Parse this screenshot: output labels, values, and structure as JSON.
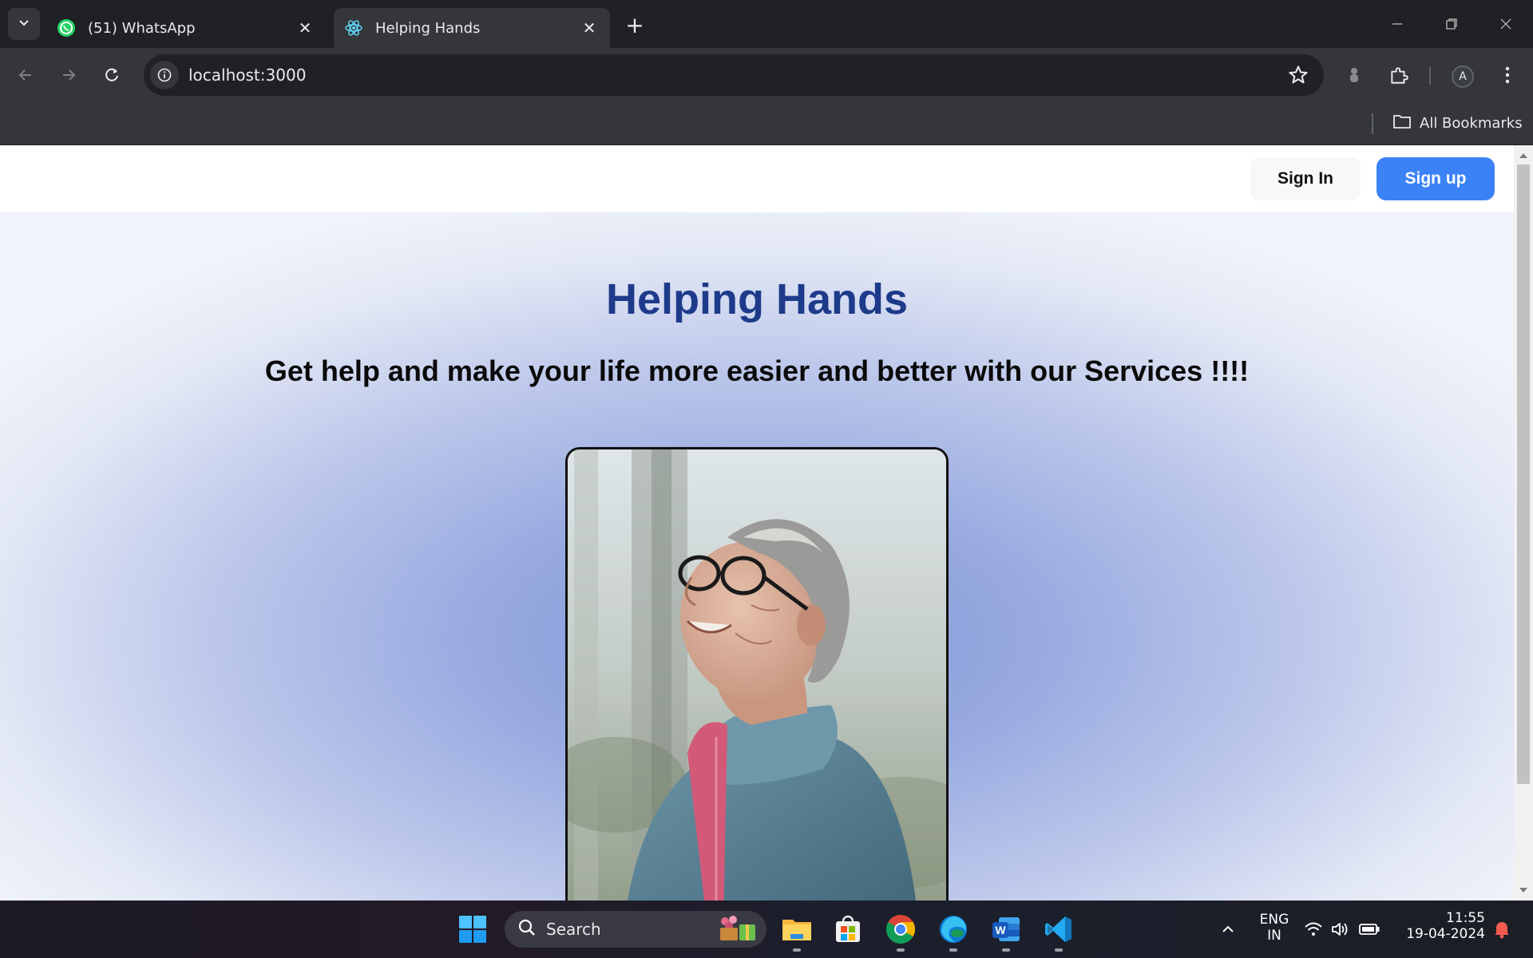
{
  "browser": {
    "tabs": [
      {
        "title": "(51) WhatsApp",
        "active": false,
        "icon": "whatsapp-icon"
      },
      {
        "title": "Helping Hands",
        "active": true,
        "icon": "react-icon"
      }
    ],
    "url": "localhost:3000",
    "bookmarks_label": "All Bookmarks",
    "profile_initial": "A"
  },
  "page": {
    "nav": {
      "signin_label": "Sign In",
      "signup_label": "Sign up"
    },
    "hero": {
      "title": "Helping Hands",
      "subtitle": "Get help and make your life more easier and better with our Services !!!!",
      "image_alt": "Elderly woman with glasses smiling and looking up"
    },
    "colors": {
      "title": "#1e3a8a",
      "signup_bg": "#3b82f6",
      "signin_bg": "#f7f8fa"
    }
  },
  "taskbar": {
    "search_placeholder": "Search",
    "lang_line1": "ENG",
    "lang_line2": "IN",
    "time": "11:55",
    "date": "19-04-2024"
  }
}
